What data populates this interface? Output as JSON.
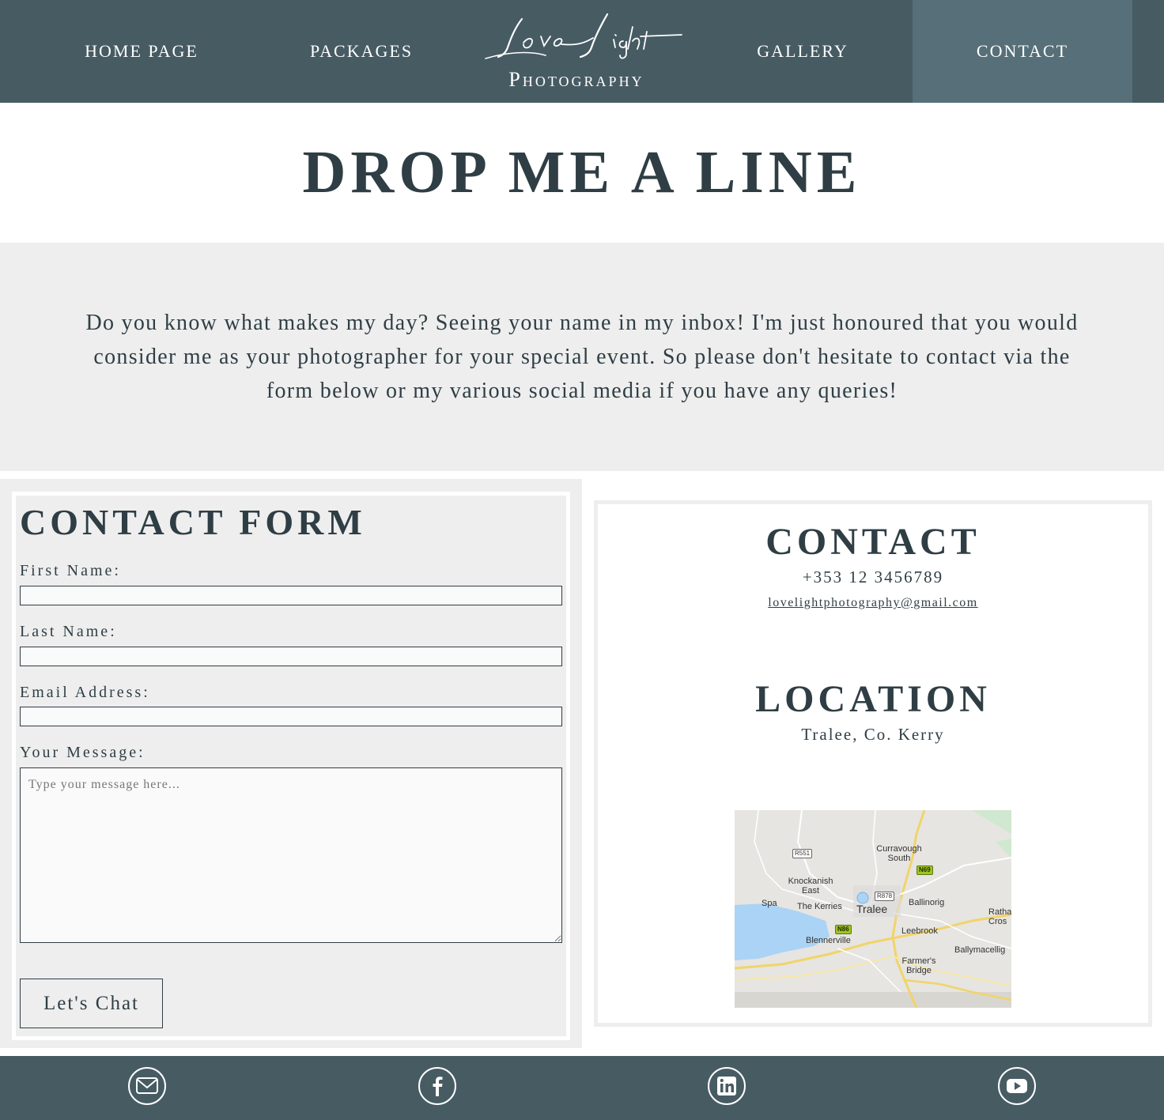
{
  "nav": {
    "home": "HOME PAGE",
    "packages": "PACKAGES",
    "gallery": "GALLERY",
    "contact": "CONTACT",
    "logo_script": "Love Light",
    "logo_word": "Photography"
  },
  "headline": "DROP ME A LINE",
  "intro": "Do you know what makes my day? Seeing your name in my inbox! I'm just honoured that you would consider me as your photographer for your special event. So please don't hesitate to contact via the form below or my various social media if you have any queries!",
  "form": {
    "title": "CONTACT FORM",
    "first_name_label": "First Name:",
    "last_name_label": "Last Name:",
    "email_label": "Email Address:",
    "message_label": "Your Message:",
    "message_placeholder": "Type your message here...",
    "submit_label": "Let's Chat"
  },
  "contact": {
    "title": "CONTACT",
    "phone": "+353 12 3456789",
    "email": "lovelightphotography@gmail.com",
    "location_title": "LOCATION",
    "location": "Tralee, Co. Kerry"
  },
  "map": {
    "places": [
      "Curravough South",
      "Knockanish East",
      "Spa",
      "The Kerries",
      "Tralee",
      "Ballinorig",
      "Ratha Cros",
      "Leebrook",
      "Blennerville",
      "Ballymacellig",
      "Farmer's Bridge"
    ],
    "roads": [
      "R551",
      "N69",
      "R878",
      "N86"
    ]
  },
  "social": [
    "email-icon",
    "facebook-icon",
    "linkedin-icon",
    "youtube-icon"
  ],
  "colors": {
    "nav_bg": "#475b63",
    "nav_active": "#566f78",
    "text": "#2f3e44",
    "panel_bg": "#eeeeee"
  }
}
